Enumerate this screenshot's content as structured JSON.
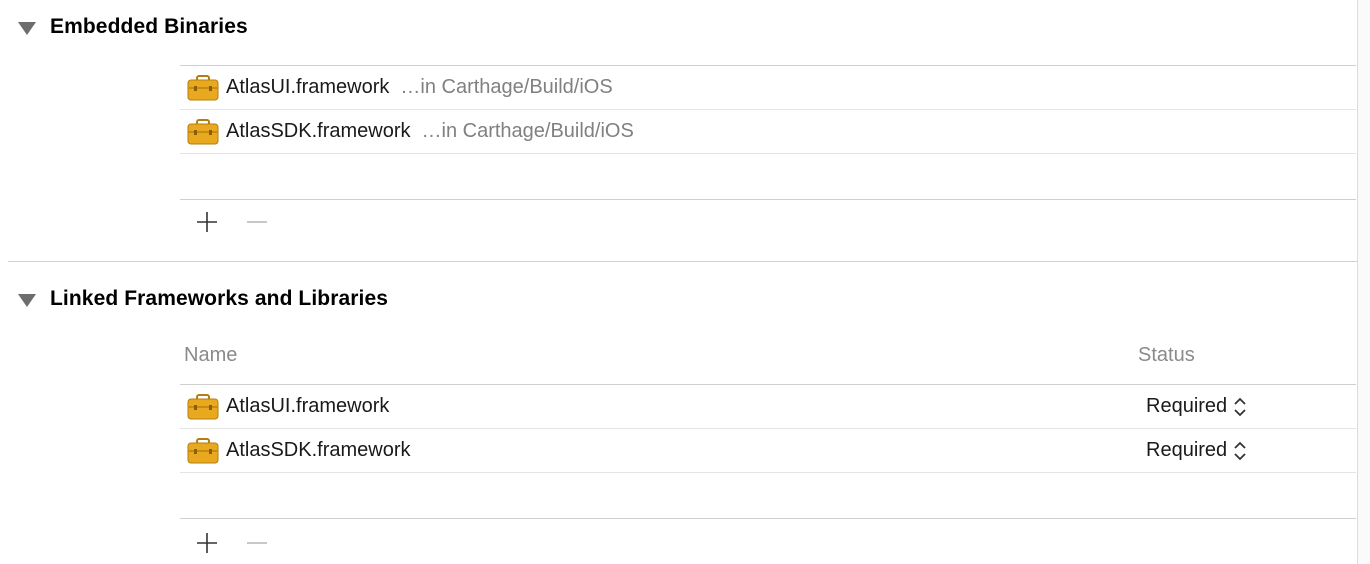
{
  "embedded_binaries": {
    "title": "Embedded Binaries",
    "items": [
      {
        "name": "AtlasUI.framework",
        "location": "…in Carthage/Build/iOS",
        "icon": "framework-toolbox-icon"
      },
      {
        "name": "AtlasSDK.framework",
        "location": "…in Carthage/Build/iOS",
        "icon": "framework-toolbox-icon"
      }
    ],
    "add_label": "+",
    "remove_label": "−"
  },
  "linked_frameworks": {
    "title": "Linked Frameworks and Libraries",
    "columns": {
      "name": "Name",
      "status": "Status"
    },
    "items": [
      {
        "name": "AtlasUI.framework",
        "status": "Required",
        "icon": "framework-toolbox-icon"
      },
      {
        "name": "AtlasSDK.framework",
        "status": "Required",
        "icon": "framework-toolbox-icon"
      }
    ],
    "add_label": "+",
    "remove_label": "−"
  },
  "colors": {
    "icon_body": "#e8a91e",
    "icon_dark": "#b57d10",
    "secondary_text": "#808080",
    "disclosure": "#6d6d6d"
  }
}
